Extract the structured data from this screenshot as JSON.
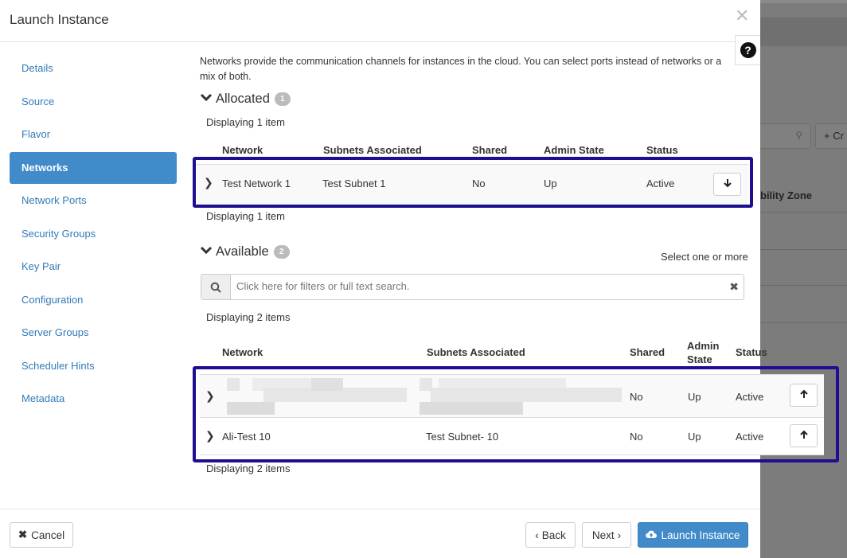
{
  "modal": {
    "title": "Launch Instance",
    "close_glyph": "✕",
    "help_glyph": "?"
  },
  "sidebar": {
    "items": [
      {
        "label": "Details"
      },
      {
        "label": "Source"
      },
      {
        "label": "Flavor"
      },
      {
        "label": "Networks",
        "active": true
      },
      {
        "label": "Network Ports"
      },
      {
        "label": "Security Groups"
      },
      {
        "label": "Key Pair"
      },
      {
        "label": "Configuration"
      },
      {
        "label": "Server Groups"
      },
      {
        "label": "Scheduler Hints"
      },
      {
        "label": "Metadata"
      }
    ]
  },
  "intro": "Networks provide the communication channels for instances in the cloud. You can select ports instead of networks or a mix of both.",
  "allocated": {
    "title": "Allocated",
    "badge": "1",
    "count_top": "Displaying 1 item",
    "count_bottom": "Displaying 1 item",
    "columns": [
      "Network",
      "Subnets Associated",
      "Shared",
      "Admin State",
      "Status"
    ],
    "rows": [
      {
        "network": "Test Network 1",
        "subnets": "Test Subnet 1",
        "shared": "No",
        "admin_state": "Up",
        "status": "Active",
        "action_icon": "arrow-down-icon"
      }
    ]
  },
  "available": {
    "title": "Available",
    "badge": "2",
    "select_hint": "Select one or more",
    "search_placeholder": "Click here for filters or full text search.",
    "count_top": "Displaying 2 items",
    "count_bottom": "Displaying 2 items",
    "columns": [
      "Network",
      "Subnets Associated",
      "Shared",
      "Admin",
      "State",
      "Status"
    ],
    "rows": [
      {
        "network": "",
        "subnets": "",
        "shared": "No",
        "admin_state": "Up",
        "status": "Active",
        "action_icon": "arrow-up-icon",
        "redacted": true
      },
      {
        "network": "Ali-Test 10",
        "subnets": "Test Subnet- 10",
        "shared": "No",
        "admin_state": "Up",
        "status": "Active",
        "action_icon": "arrow-up-icon"
      }
    ]
  },
  "footer": {
    "cancel": "Cancel",
    "back": "Back",
    "next": "Next",
    "launch": "Launch Instance"
  },
  "background": {
    "create_button": "+ Cr",
    "column_fragment": "bility Zone"
  },
  "colors": {
    "accent": "#428bca",
    "highlight_border": "#1d0f8f",
    "link": "#337ab7"
  }
}
